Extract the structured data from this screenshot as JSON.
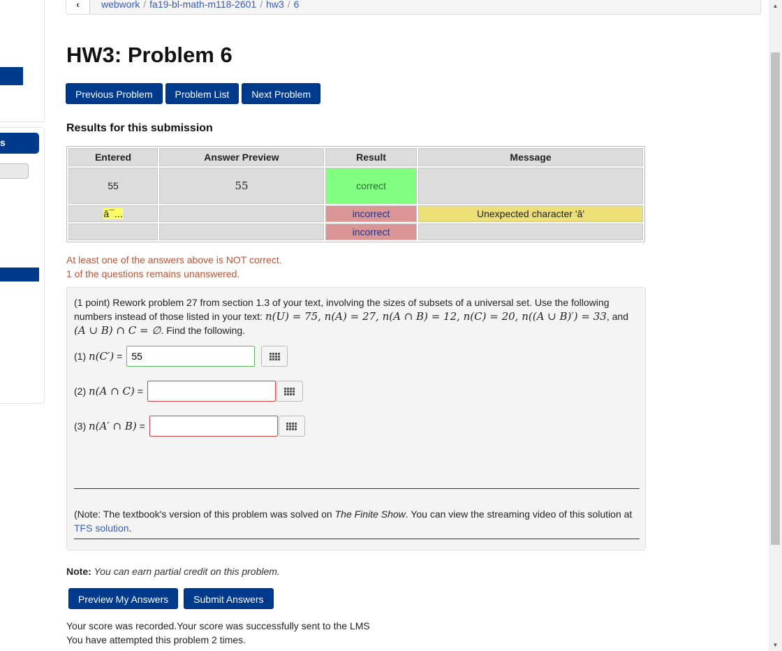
{
  "sidebar": {
    "button_fragment": "s"
  },
  "breadcrumb": {
    "items": [
      "webwork",
      "fa19-bl-math-m118-2601",
      "hw3",
      "6"
    ]
  },
  "page_title": "HW3: Problem 6",
  "nav": {
    "previous": "Previous Problem",
    "list": "Problem List",
    "next": "Next Problem"
  },
  "results": {
    "heading": "Results for this submission",
    "columns": [
      "Entered",
      "Answer Preview",
      "Result",
      "Message"
    ],
    "rows": [
      {
        "entered": "55",
        "preview": "55",
        "result": "correct",
        "message": ""
      },
      {
        "entered": "â¯...",
        "preview": "",
        "result": "incorrect",
        "message": "Unexpected character 'â'"
      },
      {
        "entered": "",
        "preview": "",
        "result": "incorrect",
        "message": ""
      }
    ]
  },
  "feedback": {
    "line1": "At least one of the answers above is NOT correct.",
    "line2": "1 of the questions remains unanswered."
  },
  "problem": {
    "intro_a": "(1 point) Rework problem 27 from section 1.3 of your text, involving the sizes of subsets of a universal set. Use the following numbers instead of those listed in your text: ",
    "given": "n(U) = 75, n(A) = 27, n(A ∩ B) = 12, n(C) = 20, n((A ∪ B)′) = 33",
    "and": ", and",
    "condition": "(A ∪ B) ∩ C = ∅",
    "intro_b": ". Find the following.",
    "questions": [
      {
        "num": "(1)",
        "expr": "n(C′)",
        "eq": "=",
        "value": "55",
        "status": "correct"
      },
      {
        "num": "(2)",
        "expr": "n(A ∩ C)",
        "eq": "=",
        "value": "",
        "status": "incorrect"
      },
      {
        "num": "(3)",
        "expr": "n(A′ ∩ B)",
        "eq": "=",
        "value": "",
        "status": "incorrect"
      }
    ],
    "note_a": "(Note: The textbook's version of this problem was solved on ",
    "note_source": "The Finite Show",
    "note_b": ". You can view the streaming video of this solution at ",
    "note_link": "TFS solution",
    "note_c": "."
  },
  "partial_credit": {
    "label": "Note:",
    "text": "You can earn partial credit on this problem."
  },
  "actions": {
    "preview": "Preview My Answers",
    "submit": "Submit Answers"
  },
  "status": {
    "line1": "Your score was recorded.Your score was successfully sent to the LMS",
    "line2": "You have attempted this problem 2 times."
  },
  "icons": {
    "back": "chevron-left-icon",
    "keypad": "keypad-grid-icon",
    "scroll_up": "triangle-up-icon",
    "scroll_down": "triangle-down-icon"
  },
  "colors": {
    "primary": "#003a8c",
    "correct": "#80ff80",
    "incorrect": "#d99694",
    "warning": "#eddf77",
    "feedback": "#b85333",
    "link": "#3a5bb0"
  }
}
